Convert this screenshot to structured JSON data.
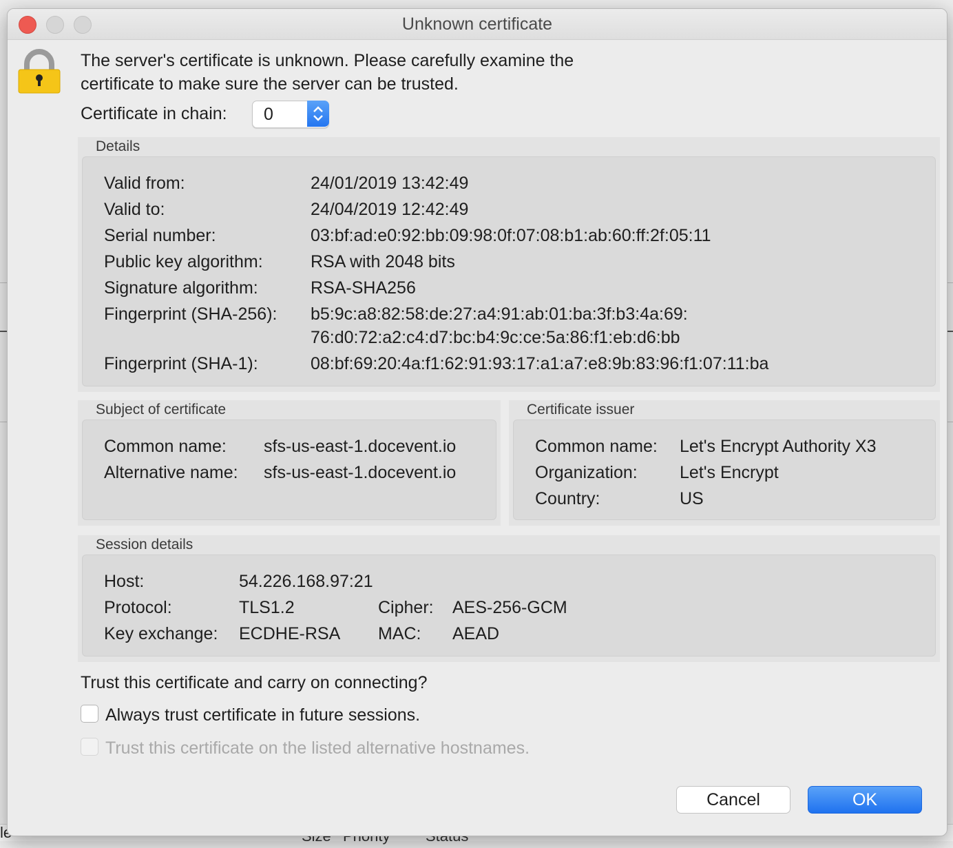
{
  "window": {
    "title": "Unknown certificate"
  },
  "message": {
    "line1": "The server's certificate is unknown. Please carefully examine the",
    "line2": "certificate to make sure the server can be trusted."
  },
  "chain": {
    "label": "Certificate in chain:",
    "value": "0"
  },
  "details": {
    "title": "Details",
    "rows": [
      {
        "label": "Valid from:",
        "value": "24/01/2019 13:42:49"
      },
      {
        "label": "Valid to:",
        "value": "24/04/2019 12:42:49"
      },
      {
        "label": "Serial number:",
        "value": "03:bf:ad:e0:92:bb:09:98:0f:07:08:b1:ab:60:ff:2f:05:11"
      },
      {
        "label": "Public key algorithm:",
        "value": "RSA with 2048 bits"
      },
      {
        "label": "Signature algorithm:",
        "value": "RSA-SHA256"
      },
      {
        "label": "Fingerprint (SHA-256):",
        "value": "b5:9c:a8:82:58:de:27:a4:91:ab:01:ba:3f:b3:4a:69:",
        "value2": "76:d0:72:a2:c4:d7:bc:b4:9c:ce:5a:86:f1:eb:d6:bb"
      },
      {
        "label": "Fingerprint (SHA-1):",
        "value": "08:bf:69:20:4a:f1:62:91:93:17:a1:a7:e8:9b:83:96:f1:07:11:ba"
      }
    ]
  },
  "subject": {
    "title": "Subject of certificate",
    "rows": [
      {
        "label": "Common name:",
        "value": "sfs-us-east-1.docevent.io"
      },
      {
        "label": "Alternative name:",
        "value": "sfs-us-east-1.docevent.io"
      }
    ]
  },
  "issuer": {
    "title": "Certificate issuer",
    "rows": [
      {
        "label": "Common name:",
        "value": "Let's Encrypt Authority X3"
      },
      {
        "label": "Organization:",
        "value": "Let's Encrypt"
      },
      {
        "label": "Country:",
        "value": "US"
      }
    ]
  },
  "session": {
    "title": "Session details",
    "host_label": "Host:",
    "host": "54.226.168.97:21",
    "protocol_label": "Protocol:",
    "protocol": "TLS1.2",
    "cipher_label": "Cipher:",
    "cipher": "AES-256-GCM",
    "kex_label": "Key exchange:",
    "kex": "ECDHE-RSA",
    "mac_label": "MAC:",
    "mac": "AEAD"
  },
  "trust": {
    "question": "Trust this certificate and carry on connecting?",
    "always": {
      "label": "Always trust certificate in future sessions.",
      "checked": false
    },
    "alt_hosts": {
      "label": "Trust this certificate on the listed alternative hostnames.",
      "checked": false,
      "disabled": true
    }
  },
  "buttons": {
    "cancel": "Cancel",
    "ok": "OK"
  },
  "background": {
    "left_fragment": "le",
    "columns": [
      "Size",
      "Priority",
      "Status"
    ]
  },
  "colors": {
    "accent": "#2576f0",
    "close": "#ee5a52",
    "lock": "#f5c518"
  },
  "icons": {
    "lock": "lock-icon",
    "stepper": "chevron-up-down-icon"
  }
}
